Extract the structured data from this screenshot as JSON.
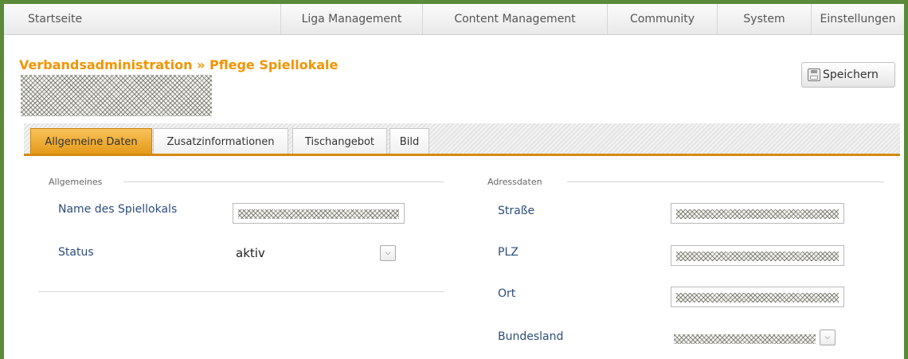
{
  "nav": {
    "items": [
      "Startseite",
      "Liga Management",
      "Content Management",
      "Community",
      "System",
      "Einstellungen"
    ]
  },
  "page": {
    "title": "Verbandsadministration » Pflege Spiellokale"
  },
  "toolbar": {
    "save_label": "Speichern",
    "save_icon": "save-disk-icon"
  },
  "tabs": [
    {
      "label": "Allgemeine Daten",
      "active": true
    },
    {
      "label": "Zusatzinformationen",
      "active": false
    },
    {
      "label": "Tischangebot",
      "active": false
    },
    {
      "label": "Bild",
      "active": false
    }
  ],
  "general": {
    "section_label": "Allgemeines",
    "name_label": "Name des Spiellokals",
    "status_label": "Status",
    "status_value": "aktiv"
  },
  "address": {
    "section_label": "Adressdaten",
    "street_label": "Straße",
    "zip_label": "PLZ",
    "city_label": "Ort",
    "state_label": "Bundesland"
  },
  "colors": {
    "accent": "#f29400",
    "border": "#5b8a3a",
    "label": "#2b4d7b"
  }
}
